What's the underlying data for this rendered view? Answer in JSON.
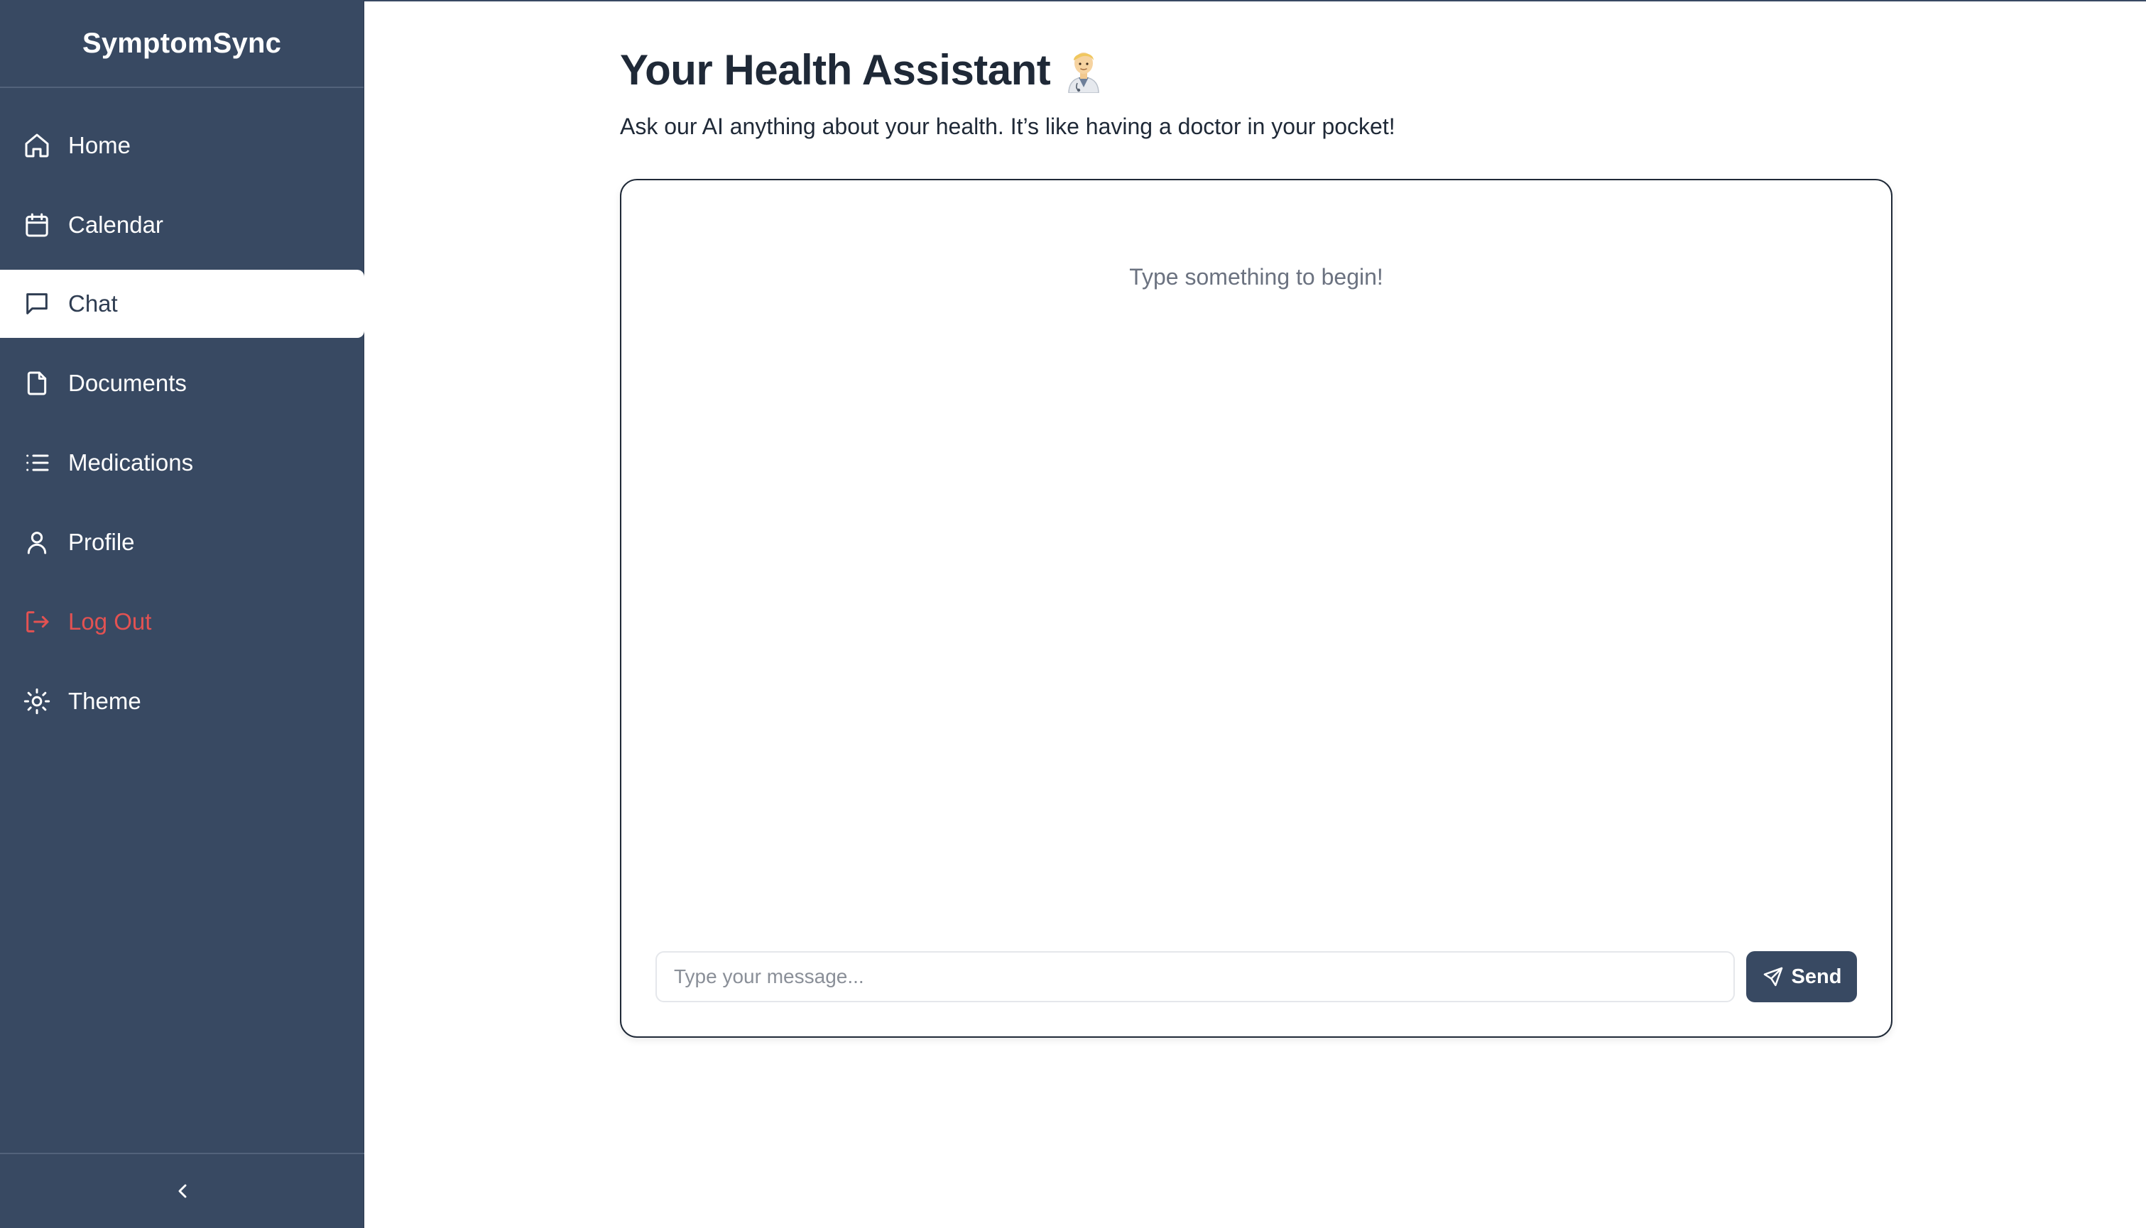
{
  "sidebar": {
    "brand": "SymptomSync",
    "items": [
      {
        "label": "Home",
        "icon": "home-icon"
      },
      {
        "label": "Calendar",
        "icon": "calendar-icon"
      },
      {
        "label": "Chat",
        "icon": "chat-icon",
        "active": true
      },
      {
        "label": "Documents",
        "icon": "document-icon"
      },
      {
        "label": "Medications",
        "icon": "list-icon"
      },
      {
        "label": "Profile",
        "icon": "user-icon"
      },
      {
        "label": "Log Out",
        "icon": "logout-icon",
        "danger": true
      },
      {
        "label": "Theme",
        "icon": "sun-icon"
      }
    ],
    "collapse_icon": "chevron-left-icon"
  },
  "main": {
    "title": "Your Health Assistant",
    "title_icon": "doctor-emoji-icon",
    "subtitle": "Ask our AI anything about your health. It’s like having a doctor in your pocket!",
    "chat": {
      "empty_hint": "Type something to begin!",
      "input_value": "",
      "input_placeholder": "Type your message...",
      "send_label": "Send",
      "send_icon": "send-icon"
    }
  },
  "colors": {
    "sidebar_bg": "#384962",
    "accent": "#384962",
    "danger": "#e35252",
    "text_dark": "#1f2937",
    "muted": "#6b7280"
  }
}
